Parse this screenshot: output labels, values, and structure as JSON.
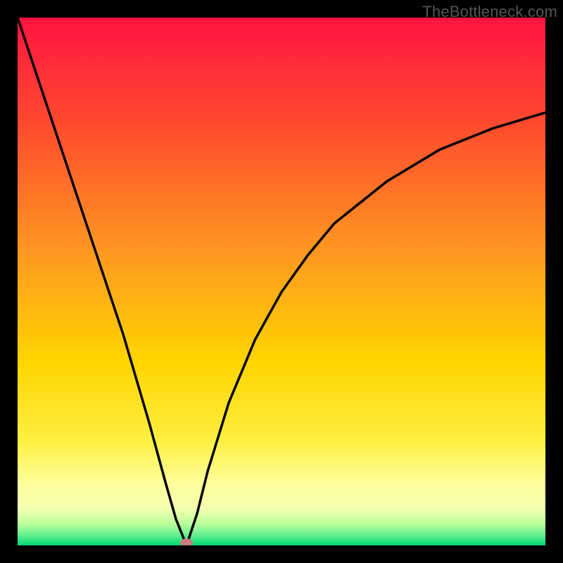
{
  "watermark": "TheBottleneck.com",
  "colors": {
    "black": "#000000",
    "gradient_top": "#ff1a3a",
    "gradient_mid1": "#ff6a2a",
    "gradient_mid2": "#ffd500",
    "gradient_mid3": "#ffff80",
    "gradient_bottom": "#00e673",
    "curve": "#000000",
    "marker": "#c97a7a"
  },
  "chart_data": {
    "type": "line",
    "title": "",
    "xlabel": "",
    "ylabel": "",
    "xlim": [
      0,
      100
    ],
    "ylim": [
      0,
      100
    ],
    "optimum_x": 32,
    "optimum_y": 0,
    "series": [
      {
        "name": "bottleneck-curve",
        "x": [
          0,
          5,
          10,
          15,
          20,
          25,
          28,
          30,
          32,
          34,
          36,
          40,
          45,
          50,
          55,
          60,
          70,
          80,
          90,
          100
        ],
        "values": [
          100,
          85,
          70,
          55,
          40,
          23,
          12,
          5,
          0,
          6,
          14,
          27,
          39,
          48,
          55,
          61,
          69,
          75,
          79,
          82
        ]
      }
    ],
    "marker": {
      "x": 32,
      "y": 0
    }
  }
}
